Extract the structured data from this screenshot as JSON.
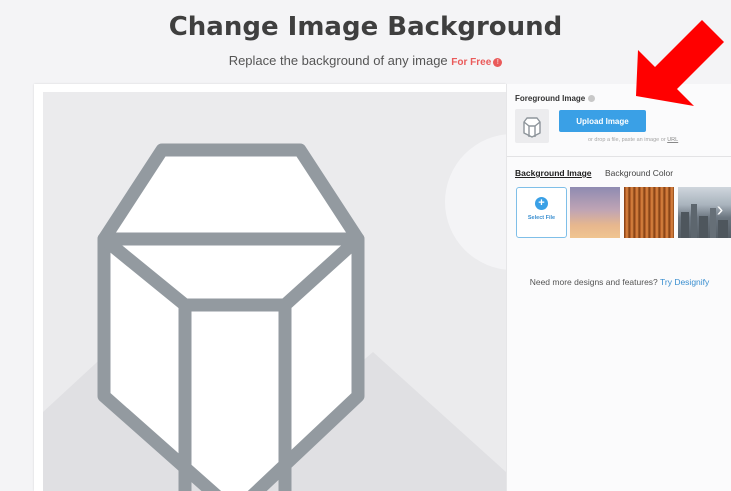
{
  "header": {
    "title": "Change Image Background",
    "subtitle": "Replace the background of any image",
    "badge": "For Free",
    "badge_icon": "info-icon"
  },
  "sidebar": {
    "foreground_label": "Foreground Image",
    "upload_button": "Upload Image",
    "drop_hint_prefix": "or drop a file, paste an image or",
    "drop_hint_link": "URL",
    "tabs": [
      {
        "label": "Background Image",
        "active": true
      },
      {
        "label": "Background Color",
        "active": false
      }
    ],
    "select_file": "Select File",
    "promo_text": "Need more designs and features?",
    "promo_link": "Try Designify"
  },
  "colors": {
    "accent": "#3aa0e6",
    "badge": "#ea5a5a",
    "annotation_arrow": "#ff0000"
  }
}
